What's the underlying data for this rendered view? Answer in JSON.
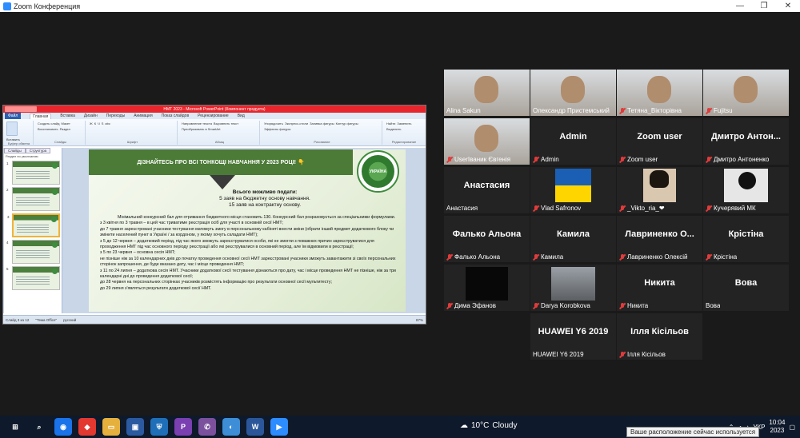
{
  "window": {
    "title": "Zoom Конференция",
    "controls": [
      "—",
      "❐",
      "✕"
    ]
  },
  "share": {
    "ppt_title": "НМТ 2023 - Microsoft PowerPoint (Компонент продукта)",
    "tabs": [
      "Файл",
      "Главная",
      "Вставка",
      "Дизайн",
      "Переходы",
      "Анимация",
      "Показ слайдов",
      "Рецензирование",
      "Вид"
    ],
    "ribbon_groups": [
      {
        "name": "Буфер обмена",
        "items": [
          "Вставить"
        ]
      },
      {
        "name": "Слайды",
        "items": [
          "Создать слайд",
          "Макет",
          "Восстановить",
          "Раздел"
        ]
      },
      {
        "name": "Шрифт",
        "items": [
          "Ж",
          "К",
          "Ч",
          "S",
          "abc"
        ]
      },
      {
        "name": "Абзац",
        "items": [
          "Направление текста",
          "Выровнять текст",
          "Преобразовать в SmartArt"
        ]
      },
      {
        "name": "Рисование",
        "items": [
          "Упорядочить",
          "Экспресс-стили",
          "Заливка фигуры",
          "Контур фигуры",
          "Эффекты фигуры"
        ]
      },
      {
        "name": "Редактирование",
        "items": [
          "Найти",
          "Заменить",
          "Выделить"
        ]
      }
    ],
    "thumb_tabs": [
      "Слайды",
      "Структура"
    ],
    "thumb_section": "Раздел по умолчанию",
    "thumbs": [
      "1",
      "2",
      "3",
      "4",
      "5"
    ],
    "selected_thumb": "3",
    "slide": {
      "banner": "ДІЗНАЙТЕСЬ ПРО ВСІ ТОНКОЩІ НАВЧАННЯ У 2023 РОЦІ! 👇",
      "seal_text": "УКРАЇНА",
      "head_title": "Всього можливо подати:",
      "head_line1": "5 заяв на бюджетну основу навчання.",
      "head_line2": "15 заяв на контрактну основу.",
      "para1": "Мінімальний конкурсний бал для отримання бюджетного місця становить 130. Конкурсний бал розраховується за спеціальними формулами.",
      "lines": [
        "з 3 квітня по 3 травня – в цей час триватиме реєстрація осіб для участі в основній сесії НМТ;",
        "до 7 травня зареєстровані учасники тестування матимуть змогу в персональному кабінеті внести зміни (обрати інший предмет додаткового блоку чи змінити населений пункт в Україні / за кордоном, у якому хочуть складати НМТ);",
        "з 5 до 12 червня – додатковий період, під час якого зможуть зареєструватися особи, які не змогли з поважних причин зареєструватися для проходження НМТ під час основного періоду реєстрації або які реєструвалися в основний період, але їм відмовили в реєстрації;",
        "з 5 по 23 червня – основна сесія НМТ;",
        "не пізніше ніж за 10 календарних днів до початку проведення основної сесії НМТ зареєстровані учасники зможуть завантажити зі своїх персональних сторінок запрошення, де буде вказано дату, час і місце проведення НМТ;",
        "з 11 по 24 липня – додаткова сесія НМТ. Учасники додаткової сесії тестування дізнаються про дату, час і місце проведення НМТ не пізніше, ніж за три календарні дні до проведення додаткової сесії;",
        "до 28 червня на персональних сторінках учасників розмістять інформацію про результати основної сесії мультитесту;",
        "до 29 липня з'являться результати додаткової сесії НМТ."
      ]
    },
    "status": {
      "slide_info": "Слайд 3 из 12",
      "theme": "\"Тема Office\"",
      "lang": "русский",
      "zoom": "87%"
    }
  },
  "participants": [
    {
      "id": "alina",
      "name": "Alina Sakun",
      "big": "",
      "muted": false,
      "kind": "photo",
      "active": true
    },
    {
      "id": "olek",
      "name": "Олександр Пристемський",
      "big": "",
      "muted": false,
      "kind": "photo"
    },
    {
      "id": "tetyana",
      "name": "Тетяна_Вікторівна",
      "big": "",
      "muted": true,
      "kind": "photo"
    },
    {
      "id": "fujitsu",
      "name": "Fujitsu",
      "big": "",
      "muted": true,
      "kind": "photo"
    },
    {
      "id": "userivanyk",
      "name": "UserІваник Євгенія",
      "big": "",
      "muted": true,
      "kind": "photo"
    },
    {
      "id": "admin",
      "name": "Admin",
      "big": "Admin",
      "muted": true,
      "kind": "text"
    },
    {
      "id": "zoomuser",
      "name": "Zoom user",
      "big": "Zoom user",
      "muted": true,
      "kind": "text"
    },
    {
      "id": "dmytro",
      "name": "Дмитро Антоненко",
      "big": "Дмитро Антон...",
      "muted": true,
      "kind": "text"
    },
    {
      "id": "anastasia",
      "name": "Анастасия",
      "big": "Анастасия",
      "muted": false,
      "kind": "text"
    },
    {
      "id": "vlad",
      "name": "Vlad Safronov",
      "big": "",
      "muted": true,
      "kind": "flag"
    },
    {
      "id": "viktoria",
      "name": "_Vikto_ria_❤",
      "big": "",
      "muted": true,
      "kind": "portrait"
    },
    {
      "id": "kucheryavyi",
      "name": "Кучерявий МК",
      "big": "",
      "muted": true,
      "kind": "bw"
    },
    {
      "id": "falko",
      "name": "Фалько Альона",
      "big": "Фалько Альона",
      "muted": true,
      "kind": "text"
    },
    {
      "id": "kamila",
      "name": "Камила",
      "big": "Камила",
      "muted": true,
      "kind": "text"
    },
    {
      "id": "lavrynenko",
      "name": "Лавриненко Олексій",
      "big": "Лавриненко О...",
      "muted": true,
      "kind": "text"
    },
    {
      "id": "kristina",
      "name": "Крістіна",
      "big": "Крістіна",
      "muted": true,
      "kind": "text"
    },
    {
      "id": "dima",
      "name": "Дима Эфанов",
      "big": "",
      "muted": true,
      "kind": "dark"
    },
    {
      "id": "darya",
      "name": "Darya Korobkova",
      "big": "",
      "muted": true,
      "kind": "winter"
    },
    {
      "id": "nikita",
      "name": "Никита",
      "big": "Никита",
      "muted": true,
      "kind": "text"
    },
    {
      "id": "vova",
      "name": "Вова",
      "big": "Вова",
      "muted": false,
      "kind": "text"
    },
    {
      "id": "huawei",
      "name": "HUAWEI Y6 2019",
      "big": "HUAWEI Y6 2019",
      "muted": false,
      "kind": "text"
    },
    {
      "id": "illya",
      "name": "Ілля Кісільов",
      "big": "Ілля Кісільов",
      "muted": true,
      "kind": "text"
    }
  ],
  "taskbar": {
    "apps": [
      {
        "name": "windows-start-icon",
        "glyph": "⊞",
        "color": "#0e1a2b"
      },
      {
        "name": "search-icon",
        "glyph": "⌕",
        "color": "#0e1a2b"
      },
      {
        "name": "chrome-icon",
        "glyph": "◉",
        "color": "#1a73e8"
      },
      {
        "name": "anydesk-icon",
        "glyph": "◆",
        "color": "#e2382f"
      },
      {
        "name": "file-explorer-icon",
        "glyph": "▭",
        "color": "#e5b03c"
      },
      {
        "name": "store-icon",
        "glyph": "▣",
        "color": "#2c5aa0"
      },
      {
        "name": "defender-icon",
        "glyph": "⛨",
        "color": "#1f6fb8"
      },
      {
        "name": "paint-icon",
        "glyph": "P",
        "color": "#7a3fb0"
      },
      {
        "name": "viber-icon",
        "glyph": "✆",
        "color": "#7b519d"
      },
      {
        "name": "teams-icon",
        "glyph": "◐",
        "color": "#3d8ed6"
      },
      {
        "name": "word-icon",
        "glyph": "W",
        "color": "#2b579a"
      },
      {
        "name": "zoom-icon",
        "glyph": "▶",
        "color": "#2d8cff"
      }
    ],
    "weather_temp": "10°C",
    "weather_text": "Cloudy",
    "lang": "УКР",
    "time": "10:04",
    "date": "2023"
  },
  "tooltip": "Ваше расположение сейчас используется"
}
